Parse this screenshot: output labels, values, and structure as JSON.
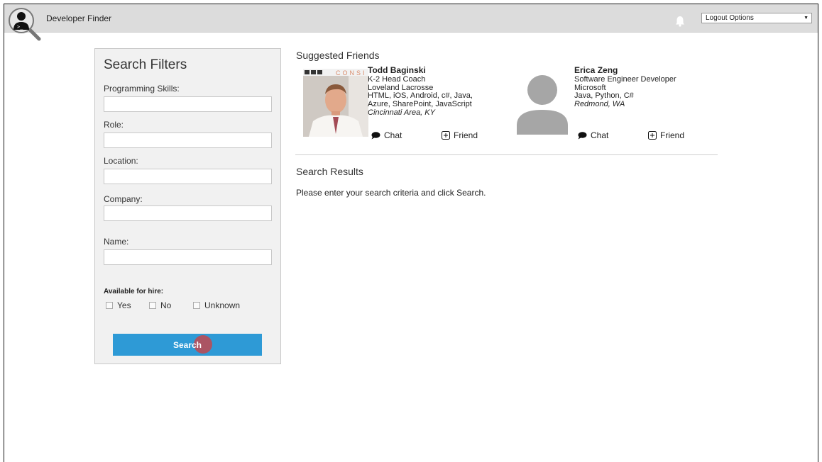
{
  "header": {
    "app_title": "Developer Finder",
    "logout_label": "Logout Options",
    "logout_caret": "▼"
  },
  "filters": {
    "title": "Search Filters",
    "fields": [
      {
        "label": "Programming Skills:",
        "value": ""
      },
      {
        "label": "Role:",
        "value": ""
      },
      {
        "label": "Location:",
        "value": ""
      },
      {
        "label": "Company:",
        "value": ""
      },
      {
        "label": "Name:",
        "value": ""
      }
    ],
    "hire_label": "Available for hire:",
    "hire_options": [
      {
        "label": "Yes",
        "checked": false
      },
      {
        "label": "No",
        "checked": false
      },
      {
        "label": "Unknown",
        "checked": false
      }
    ],
    "search_label": "Search"
  },
  "suggested": {
    "title": "Suggested Friends",
    "friends": [
      {
        "name": "Todd Baginski",
        "role": "K-2 Head Coach",
        "company": "Loveland Lacrosse",
        "skills": "HTML, iOS, Android, c#, Java, Azure, SharePoint, JavaScript",
        "location": "Cincinnati Area, KY",
        "chat_label": "Chat",
        "friend_label": "Friend",
        "photo_banner_text": "CONSI"
      },
      {
        "name": "Erica Zeng",
        "role": "Software Engineer Developer",
        "company": "Microsoft",
        "skills": "Java, Python, C#",
        "location": "Redmond, WA",
        "chat_label": "Chat",
        "friend_label": "Friend"
      }
    ]
  },
  "results": {
    "title": "Search Results",
    "message": "Please enter your search criteria and click Search."
  },
  "colors": {
    "topbar": "#dcdcdc",
    "panel": "#f1f1f1",
    "accent_button": "#2e9ad6",
    "click_indicator": "#d63c3c",
    "avatar_placeholder": "#a6a6a6"
  }
}
